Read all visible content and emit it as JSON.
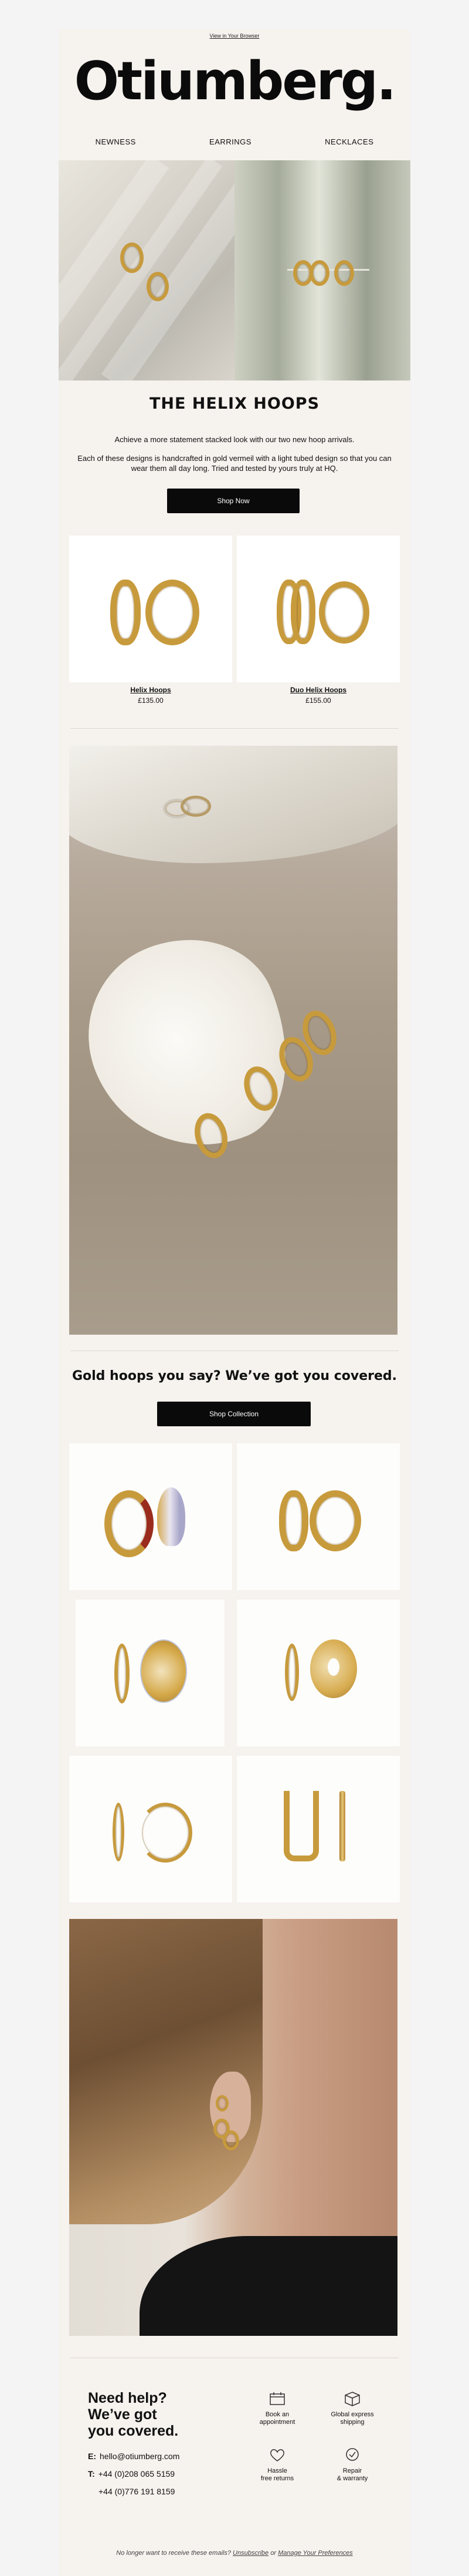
{
  "header": {
    "view_in_browser": "View in Your Browser",
    "logo": "Otiumberg."
  },
  "nav": {
    "items": [
      "NEWNESS",
      "EARRINGS",
      "NECKLACES"
    ]
  },
  "hero_section": {
    "title": "THE HELIX HOOPS",
    "paragraph_1": "Achieve a more statement stacked look with our two new hoop arrivals.",
    "paragraph_2": "Each of these designs is handcrafted in gold vermeil with a light tubed design so that you can wear them all day long. Tried and tested by yours truly at HQ.",
    "cta": "Shop Now"
  },
  "products": [
    {
      "name": "Helix Hoops",
      "price": "£135.00"
    },
    {
      "name": "Duo Helix Hoops",
      "price": "£155.00"
    }
  ],
  "gold_section": {
    "title": "Gold hoops you say? We’ve got you covered.",
    "cta": "Shop Collection"
  },
  "help": {
    "title_line_1": "Need help?",
    "title_line_2": "We’ve got",
    "title_line_3": "you covered.",
    "email_label": "E:",
    "email": "hello@otiumberg.com",
    "tel_label": "T:",
    "phone_1": "+44 (0)208 065 5159",
    "phone_2": "+44 (0)776 191 8159",
    "services": [
      {
        "line1": "Book an",
        "line2": "appointment",
        "icon": "calendar-icon"
      },
      {
        "line1": "Global express",
        "line2": "shipping",
        "icon": "box-icon"
      },
      {
        "line1": "Hassle",
        "line2": "free returns",
        "icon": "heart-icon"
      },
      {
        "line1": "Repair",
        "line2": "& warranty",
        "icon": "badge-check-icon"
      }
    ]
  },
  "footer": {
    "prefix": "No longer want to receive these emails?",
    "unsubscribe": "Unsubscribe",
    "or": "or",
    "manage": "Manage Your Preferences"
  },
  "colors": {
    "background": "#f6f2ee",
    "button": "#0a0a0a",
    "gold": "#c79a3c"
  }
}
